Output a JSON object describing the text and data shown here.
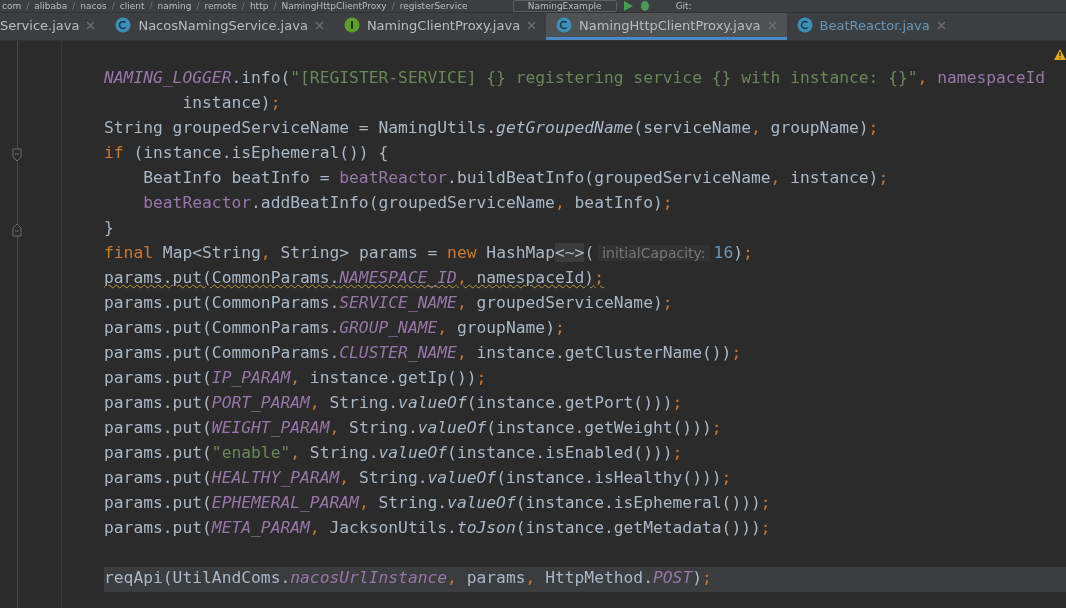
{
  "toolbar": {
    "separator": "/",
    "breadcrumbs": [
      "com",
      "alibaba",
      "nacos",
      "client",
      "naming",
      "remote",
      "http",
      "NamingHttpClientProxy",
      "registerService"
    ],
    "run_config": "NamingExample",
    "vcs_label": "Git:"
  },
  "tabs": [
    {
      "label": "Service.java",
      "selected": false,
      "modified": false
    },
    {
      "label": "NacosNamingService.java",
      "kind": "class",
      "selected": false,
      "modified": false
    },
    {
      "label": "NamingClientProxy.java",
      "kind": "interface",
      "selected": false,
      "modified": false
    },
    {
      "label": "NamingHttpClientProxy.java",
      "kind": "class",
      "selected": true,
      "modified": false
    },
    {
      "label": "BeatReactor.java",
      "kind": "class",
      "selected": false,
      "modified": true
    }
  ],
  "editor": {
    "warning": true,
    "lines": [
      {
        "current": false,
        "warning": false,
        "tokens": [
          {
            "text": "NAMING_LOGGER",
            "kind": "static"
          },
          {
            "text": ".info(",
            "kind": "plain"
          },
          {
            "text": "\"[REGISTER-SERVICE] {} registering service {} with instance: {}\"",
            "kind": "str"
          },
          {
            "text": ", ",
            "kind": "kw"
          },
          {
            "text": "namespaceId",
            "kind": "field"
          }
        ]
      },
      {
        "current": false,
        "warning": false,
        "tokens": [
          {
            "text": "        instance)",
            "kind": "plain"
          },
          {
            "text": ";",
            "kind": "kw"
          }
        ]
      },
      {
        "current": false,
        "warning": false,
        "tokens": [
          {
            "text": "String groupedServiceName = NamingUtils.",
            "kind": "plain"
          },
          {
            "text": "getGroupedName",
            "kind": "italic"
          },
          {
            "text": "(serviceName",
            "kind": "plain"
          },
          {
            "text": ", ",
            "kind": "kw"
          },
          {
            "text": "groupName)",
            "kind": "plain"
          },
          {
            "text": ";",
            "kind": "kw"
          }
        ]
      },
      {
        "current": false,
        "warning": false,
        "kind": "fold_start",
        "tokens": [
          {
            "text": "if ",
            "kind": "kw"
          },
          {
            "text": "(instance.isEphemeral()) {",
            "kind": "plain"
          }
        ]
      },
      {
        "current": false,
        "warning": false,
        "tokens": [
          {
            "text": "    BeatInfo beatInfo = ",
            "kind": "plain"
          },
          {
            "text": "beatReactor",
            "kind": "field"
          },
          {
            "text": ".buildBeatInfo(groupedServiceName",
            "kind": "plain"
          },
          {
            "text": ", ",
            "kind": "kw"
          },
          {
            "text": "instance)",
            "kind": "plain"
          },
          {
            "text": ";",
            "kind": "kw"
          }
        ]
      },
      {
        "current": false,
        "warning": false,
        "tokens": [
          {
            "text": "    beatReactor",
            "kind": "field"
          },
          {
            "text": ".addBeatInfo(groupedServiceName",
            "kind": "plain"
          },
          {
            "text": ", ",
            "kind": "kw"
          },
          {
            "text": "beatInfo)",
            "kind": "plain"
          },
          {
            "text": ";",
            "kind": "kw"
          }
        ]
      },
      {
        "current": false,
        "warning": false,
        "kind": "fold_end",
        "tokens": [
          {
            "text": "}",
            "kind": "plain"
          }
        ]
      },
      {
        "current": false,
        "warning": false,
        "tokens": [
          {
            "text": "final ",
            "kind": "kw"
          },
          {
            "text": "Map<String",
            "kind": "plain"
          },
          {
            "text": ", ",
            "kind": "kw"
          },
          {
            "text": "String> params = ",
            "kind": "plain"
          },
          {
            "text": "new ",
            "kind": "kw"
          },
          {
            "text": "HashMap",
            "kind": "plain"
          },
          {
            "text": "<~>",
            "kind": "fold"
          },
          {
            "text": "(",
            "kind": "plain"
          },
          {
            "text": "initialCapacity:",
            "kind": "hint"
          },
          {
            "text": "16",
            "kind": "num"
          },
          {
            "text": ")",
            "kind": "plain"
          },
          {
            "text": ";",
            "kind": "kw"
          }
        ]
      },
      {
        "current": false,
        "warning": true,
        "tokens": [
          {
            "text": "params.put(CommonParams.",
            "kind": "plain"
          },
          {
            "text": "NAMESPACE_ID",
            "kind": "static"
          },
          {
            "text": ", ",
            "kind": "kw"
          },
          {
            "text": "namespaceId)",
            "kind": "plain"
          },
          {
            "text": ";",
            "kind": "kw"
          }
        ]
      },
      {
        "current": false,
        "warning": false,
        "tokens": [
          {
            "text": "params.put(CommonParams.",
            "kind": "plain"
          },
          {
            "text": "SERVICE_NAME",
            "kind": "static"
          },
          {
            "text": ", ",
            "kind": "kw"
          },
          {
            "text": "groupedServiceName)",
            "kind": "plain"
          },
          {
            "text": ";",
            "kind": "kw"
          }
        ]
      },
      {
        "current": false,
        "warning": false,
        "tokens": [
          {
            "text": "params.put(CommonParams.",
            "kind": "plain"
          },
          {
            "text": "GROUP_NAME",
            "kind": "static"
          },
          {
            "text": ", ",
            "kind": "kw"
          },
          {
            "text": "groupName)",
            "kind": "plain"
          },
          {
            "text": ";",
            "kind": "kw"
          }
        ]
      },
      {
        "current": false,
        "warning": false,
        "tokens": [
          {
            "text": "params.put(CommonParams.",
            "kind": "plain"
          },
          {
            "text": "CLUSTER_NAME",
            "kind": "static"
          },
          {
            "text": ", ",
            "kind": "kw"
          },
          {
            "text": "instance.getClusterName())",
            "kind": "plain"
          },
          {
            "text": ";",
            "kind": "kw"
          }
        ]
      },
      {
        "current": false,
        "warning": false,
        "tokens": [
          {
            "text": "params.put(",
            "kind": "plain"
          },
          {
            "text": "IP_PARAM",
            "kind": "static"
          },
          {
            "text": ", ",
            "kind": "kw"
          },
          {
            "text": "instance.getIp())",
            "kind": "plain"
          },
          {
            "text": ";",
            "kind": "kw"
          }
        ]
      },
      {
        "current": false,
        "warning": false,
        "tokens": [
          {
            "text": "params.put(",
            "kind": "plain"
          },
          {
            "text": "PORT_PARAM",
            "kind": "static"
          },
          {
            "text": ", ",
            "kind": "kw"
          },
          {
            "text": "String.",
            "kind": "plain"
          },
          {
            "text": "valueOf",
            "kind": "italic"
          },
          {
            "text": "(instance.getPort()))",
            "kind": "plain"
          },
          {
            "text": ";",
            "kind": "kw"
          }
        ]
      },
      {
        "current": false,
        "warning": false,
        "tokens": [
          {
            "text": "params.put(",
            "kind": "plain"
          },
          {
            "text": "WEIGHT_PARAM",
            "kind": "static"
          },
          {
            "text": ", ",
            "kind": "kw"
          },
          {
            "text": "String.",
            "kind": "plain"
          },
          {
            "text": "valueOf",
            "kind": "italic"
          },
          {
            "text": "(instance.getWeight()))",
            "kind": "plain"
          },
          {
            "text": ";",
            "kind": "kw"
          }
        ]
      },
      {
        "current": false,
        "warning": false,
        "tokens": [
          {
            "text": "params.put(",
            "kind": "plain"
          },
          {
            "text": "\"enable\"",
            "kind": "str"
          },
          {
            "text": ", ",
            "kind": "kw"
          },
          {
            "text": "String.",
            "kind": "plain"
          },
          {
            "text": "valueOf",
            "kind": "italic"
          },
          {
            "text": "(instance.isEnabled()))",
            "kind": "plain"
          },
          {
            "text": ";",
            "kind": "kw"
          }
        ]
      },
      {
        "current": false,
        "warning": false,
        "tokens": [
          {
            "text": "params.put(",
            "kind": "plain"
          },
          {
            "text": "HEALTHY_PARAM",
            "kind": "static"
          },
          {
            "text": ", ",
            "kind": "kw"
          },
          {
            "text": "String.",
            "kind": "plain"
          },
          {
            "text": "valueOf",
            "kind": "italic"
          },
          {
            "text": "(instance.isHealthy()))",
            "kind": "plain"
          },
          {
            "text": ";",
            "kind": "kw"
          }
        ]
      },
      {
        "current": false,
        "warning": false,
        "tokens": [
          {
            "text": "params.put(",
            "kind": "plain"
          },
          {
            "text": "EPHEMERAL_PARAM",
            "kind": "static"
          },
          {
            "text": ", ",
            "kind": "kw"
          },
          {
            "text": "String.",
            "kind": "plain"
          },
          {
            "text": "valueOf",
            "kind": "italic"
          },
          {
            "text": "(instance.isEphemeral()))",
            "kind": "plain"
          },
          {
            "text": ";",
            "kind": "kw"
          }
        ]
      },
      {
        "current": false,
        "warning": false,
        "tokens": [
          {
            "text": "params.put(",
            "kind": "plain"
          },
          {
            "text": "META_PARAM",
            "kind": "static"
          },
          {
            "text": ", ",
            "kind": "kw"
          },
          {
            "text": "JacksonUtils.",
            "kind": "plain"
          },
          {
            "text": "toJson",
            "kind": "italic"
          },
          {
            "text": "(instance.getMetadata()))",
            "kind": "plain"
          },
          {
            "text": ";",
            "kind": "kw"
          }
        ]
      },
      {
        "kind": "blank"
      },
      {
        "current": true,
        "warning": false,
        "tokens": [
          {
            "text": "reqApi(UtilAndComs.",
            "kind": "plain"
          },
          {
            "text": "nacosUrlInstance",
            "kind": "static"
          },
          {
            "text": ", ",
            "kind": "kw"
          },
          {
            "text": "params",
            "kind": "plain"
          },
          {
            "text": ", ",
            "kind": "kw"
          },
          {
            "text": "HttpMethod.",
            "kind": "plain"
          },
          {
            "text": "POST",
            "kind": "static"
          },
          {
            "text": ")",
            "kind": "plain"
          },
          {
            "text": ";",
            "kind": "kw"
          }
        ]
      }
    ]
  }
}
